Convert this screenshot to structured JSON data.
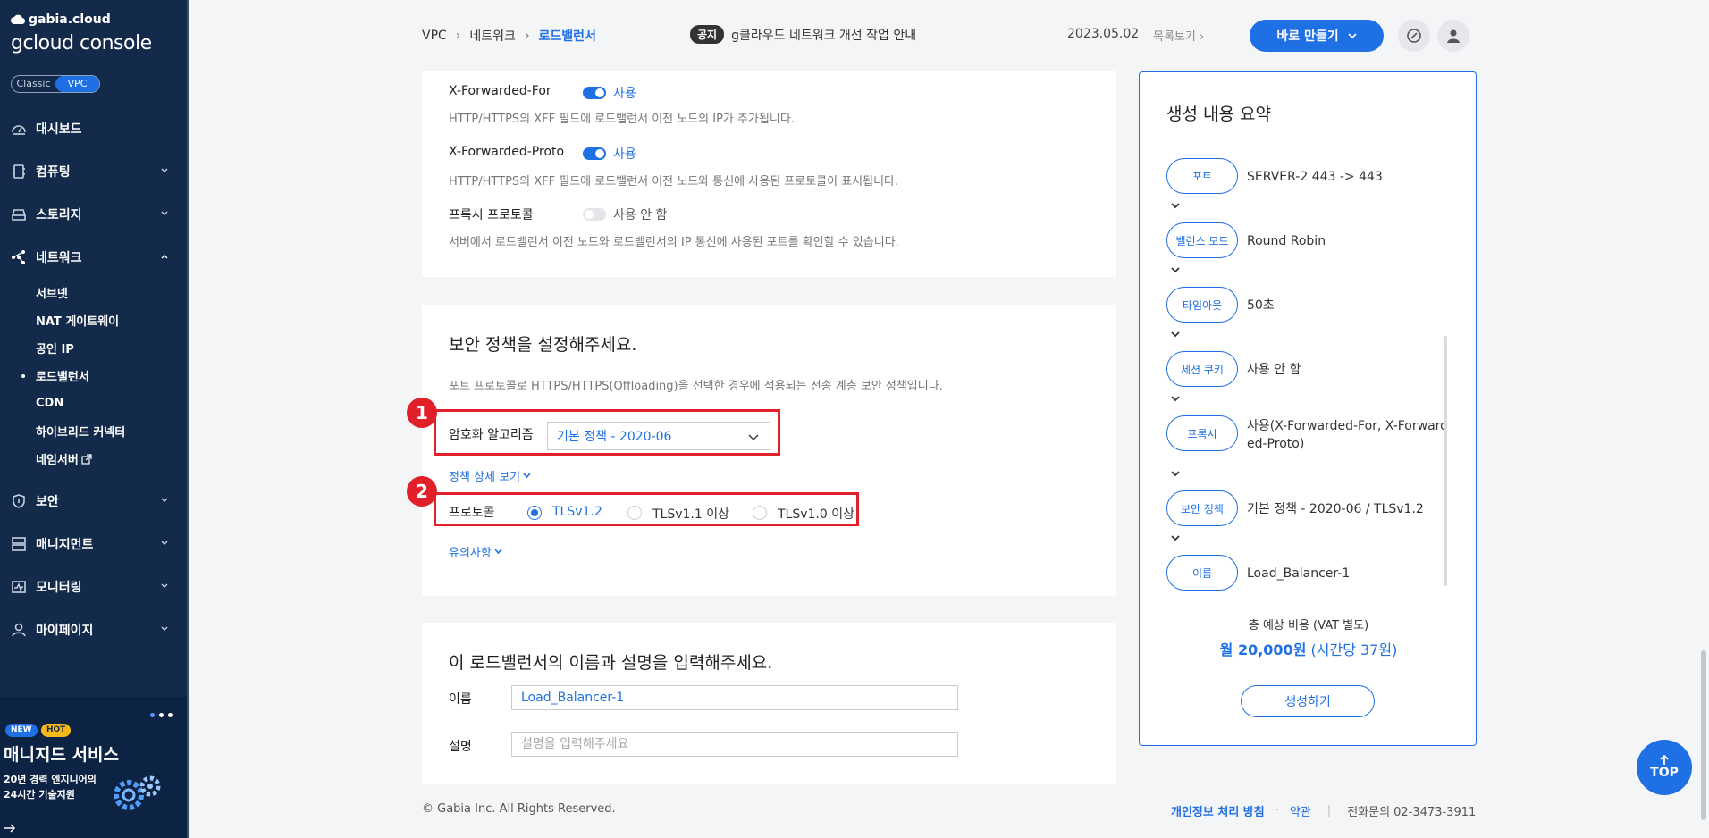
{
  "sidebar": {
    "logo_small": "gabia.cloud",
    "logo_big": "gcloud console",
    "toggle": {
      "classic": "Classic",
      "vpc": "VPC"
    },
    "items": [
      {
        "label": "대시보드",
        "icon": "dashboard-icon"
      },
      {
        "label": "컴퓨팅",
        "icon": "server-icon"
      },
      {
        "label": "스토리지",
        "icon": "storage-icon"
      },
      {
        "label": "네트워크",
        "icon": "network-icon"
      },
      {
        "label": "보안",
        "icon": "shield-icon"
      },
      {
        "label": "매니지먼트",
        "icon": "management-icon"
      },
      {
        "label": "모니터링",
        "icon": "monitor-icon"
      },
      {
        "label": "마이페이지",
        "icon": "user-icon"
      }
    ],
    "network_sub": [
      "서브넷",
      "NAT 게이트웨이",
      "공인 IP",
      "로드밸런서",
      "CDN",
      "하이브리드 커넥터",
      "네임서버"
    ],
    "promo": {
      "badge_new": "NEW",
      "badge_hot": "HOT",
      "title": "매니지드 서비스",
      "line1": "20년 경력 엔지니어의",
      "line2": "24시간 기술지원"
    }
  },
  "header": {
    "breadcrumb": [
      "VPC",
      "네트워크",
      "로드밸런서"
    ],
    "notice_tag": "공지",
    "notice_text": "g클라우드 네트워크 개선 작업 안내",
    "notice_date": "2023.05.02",
    "notice_more": "목록보기",
    "create_button": "바로 만들기"
  },
  "proxy": {
    "xff_label": "X-Forwarded-For",
    "xff_state": "사용",
    "xff_desc": "HTTP/HTTPS의 XFF 필드에 로드밸런서 이전 노드의 IP가 추가됩니다.",
    "xfp_label": "X-Forwarded-Proto",
    "xfp_state": "사용",
    "xfp_desc": "HTTP/HTTPS의 XFF 필드에 로드밸런서 이전 노드와 통신에 사용된 프로토콜이 표시됩니다.",
    "pp_label": "프록시 프로토콜",
    "pp_state": "사용 안 함",
    "pp_desc": "서버에서 로드밸런서 이전 노드와 로드밸런서의 IP 통신에 사용된 포트를 확인할 수 있습니다."
  },
  "security": {
    "title": "보안 정책을 설정해주세요.",
    "desc": "포트 프로토콜로 HTTPS/HTTPS(Offloading)을 선택한 경우에 적용되는 전송 계층 보안 정책입니다.",
    "badge1": "1",
    "badge2": "2",
    "cipher_label": "암호화 알고리즘",
    "cipher_value": "기본 정책 - 2020-06",
    "policy_detail": "정책 상세 보기",
    "protocol_label": "프로토콜",
    "protocols": [
      "TLSv1.2",
      "TLSv1.1 이상",
      "TLSv1.0 이상"
    ],
    "selected_protocol": "TLSv1.2",
    "notes": "유의사항"
  },
  "naming": {
    "title": "이 로드밸런서의 이름과 설명을 입력해주세요.",
    "name_label": "이름",
    "name_value": "Load_Balancer-1",
    "desc_label": "설명",
    "desc_placeholder": "설명을 입력해주세요"
  },
  "summary": {
    "title": "생성 내용 요약",
    "rows": [
      {
        "key": "포트",
        "value": "SERVER-2 443 -> 443"
      },
      {
        "key": "밸런스 모드",
        "value": "Round Robin"
      },
      {
        "key": "타임아웃",
        "value": "50초"
      },
      {
        "key": "세션 쿠키",
        "value": "사용 안 함"
      },
      {
        "key": "프록시",
        "value": "사용(X-Forwarded-For, X-Forwarded-Proto)"
      },
      {
        "key": "보안 정책",
        "value": "기본 정책 - 2020-06 / TLSv1.2"
      },
      {
        "key": "이름",
        "value": "Load_Balancer-1"
      }
    ],
    "total_label": "총 예상 비용 (VAT 별도)",
    "total_price": "월 20,000원",
    "total_hourly": "(시간당 37원)",
    "create_button": "생성하기"
  },
  "top_button": "TOP",
  "footer": {
    "copyright": "© Gabia Inc. All Rights Reserved.",
    "privacy": "개인정보 처리 방침",
    "dot": "·",
    "terms": "약관",
    "bar": "|",
    "phone": "전화문의 02-3473-3911"
  },
  "colors": {
    "accent": "#1f6fe5",
    "sidebar": "#132a4a",
    "highlight": "#e1202a"
  }
}
